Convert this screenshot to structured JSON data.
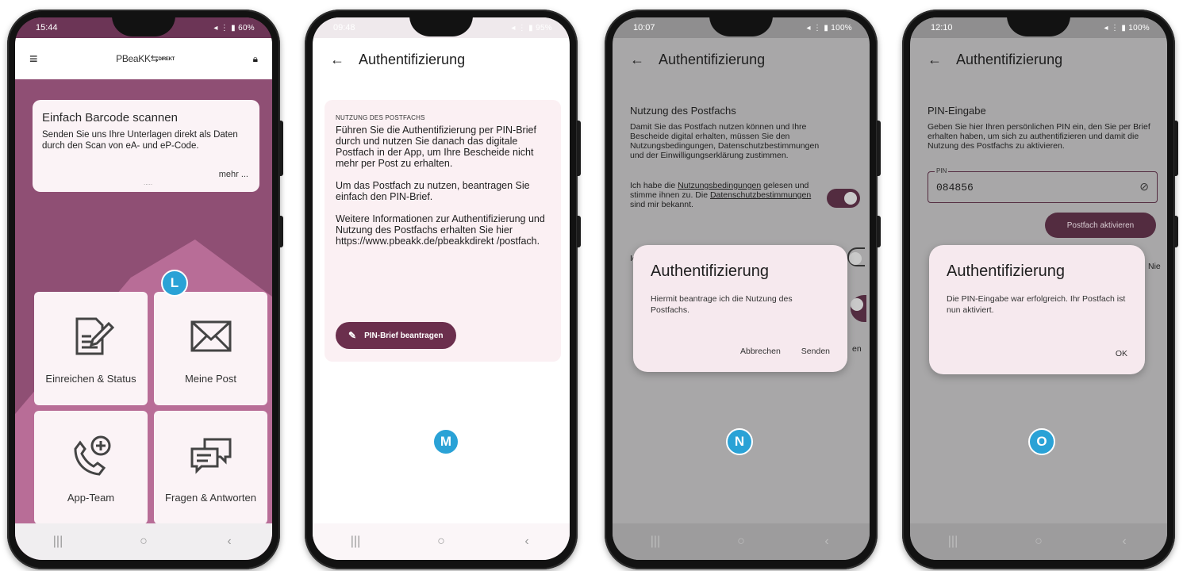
{
  "screen1": {
    "status_time": "15:44",
    "status_right": "60%",
    "logo_text": "PBeaKK",
    "logo_suffix": "DIREKT",
    "card_title": "Einfach Barcode scannen",
    "card_text": "Senden Sie uns Ihre Unterlagen direkt als Daten durch den Scan von eA- und eP-Code.",
    "card_more": "mehr ...",
    "tiles": [
      {
        "label": "Einreichen & Status",
        "icon": "document-edit-icon"
      },
      {
        "label": "Meine Post",
        "icon": "envelope-icon"
      },
      {
        "label": "App-Team",
        "icon": "phone-plus-icon"
      },
      {
        "label": "Fragen & Antworten",
        "icon": "chat-bubbles-icon"
      }
    ],
    "badge": "L"
  },
  "screen2": {
    "status_time": "09:48",
    "status_right": "95%",
    "title": "Authentifizierung",
    "overline": "NUTZUNG DES POSTFACHS",
    "para1": "Führen Sie die Authentifizierung per PIN-Brief durch und nutzen Sie danach das digitale Postfach in der App, um Ihre Bescheide nicht mehr per Post zu erhalten.",
    "para2": "Um das Postfach zu nutzen, beantragen Sie einfach den PIN-Brief.",
    "para3": "Weitere Informationen zur Authentifizierung und Nutzung des Postfachs erhalten Sie hier https://www.pbeakk.de/pbeakkdirekt /postfach.",
    "button": "PIN-Brief beantragen",
    "badge": "M"
  },
  "screen3": {
    "status_time": "10:07",
    "status_right": "100%",
    "title": "Authentifizierung",
    "section_title": "Nutzung des Postfachs",
    "section_text": "Damit Sie das Postfach nutzen können und Ihre Bescheide digital erhalten, müssen Sie den Nutzungsbedingungen, Datenschutzbestimmungen und der Einwilligungserklärung zustimmen.",
    "consent_prefix": "Ich habe die ",
    "consent_link1": "Nutzungsbedingungen",
    "consent_mid": " gelesen und stimme ihnen zu. Die ",
    "consent_link2": "Datenschutzbestimmungen",
    "consent_suffix": " sind mir bekannt.",
    "partial_ich": "Ich",
    "partial_en": "en",
    "dialog_title": "Authentifizierung",
    "dialog_text": "Hiermit beantrage ich die Nutzung des Postfachs.",
    "dialog_cancel": "Abbrechen",
    "dialog_send": "Senden",
    "badge": "N"
  },
  "screen4": {
    "status_time": "12:10",
    "status_right": "100%",
    "title": "Authentifizierung",
    "section_title": "PIN-Eingabe",
    "section_text": "Geben Sie hier Ihren persönlichen PIN ein, den Sie per Brief erhalten haben, um sich zu authentifizieren und damit die Nutzung des Postfachs zu aktivieren.",
    "pin_label": "PIN",
    "pin_value": "084856",
    "activate_button": "Postfach aktivieren",
    "partial_nie": "Nie",
    "dialog_title": "Authentifizierung",
    "dialog_text": "Die PIN-Eingabe war erfolgreich. Ihr Postfach ist nun aktiviert.",
    "dialog_ok": "OK",
    "badge": "O"
  },
  "navbar": {
    "recent": "|||",
    "home": "○",
    "back": "‹"
  },
  "colors": {
    "brand": "#8f4f74",
    "button": "#6b2f4d",
    "badge": "#2aa2d6"
  }
}
